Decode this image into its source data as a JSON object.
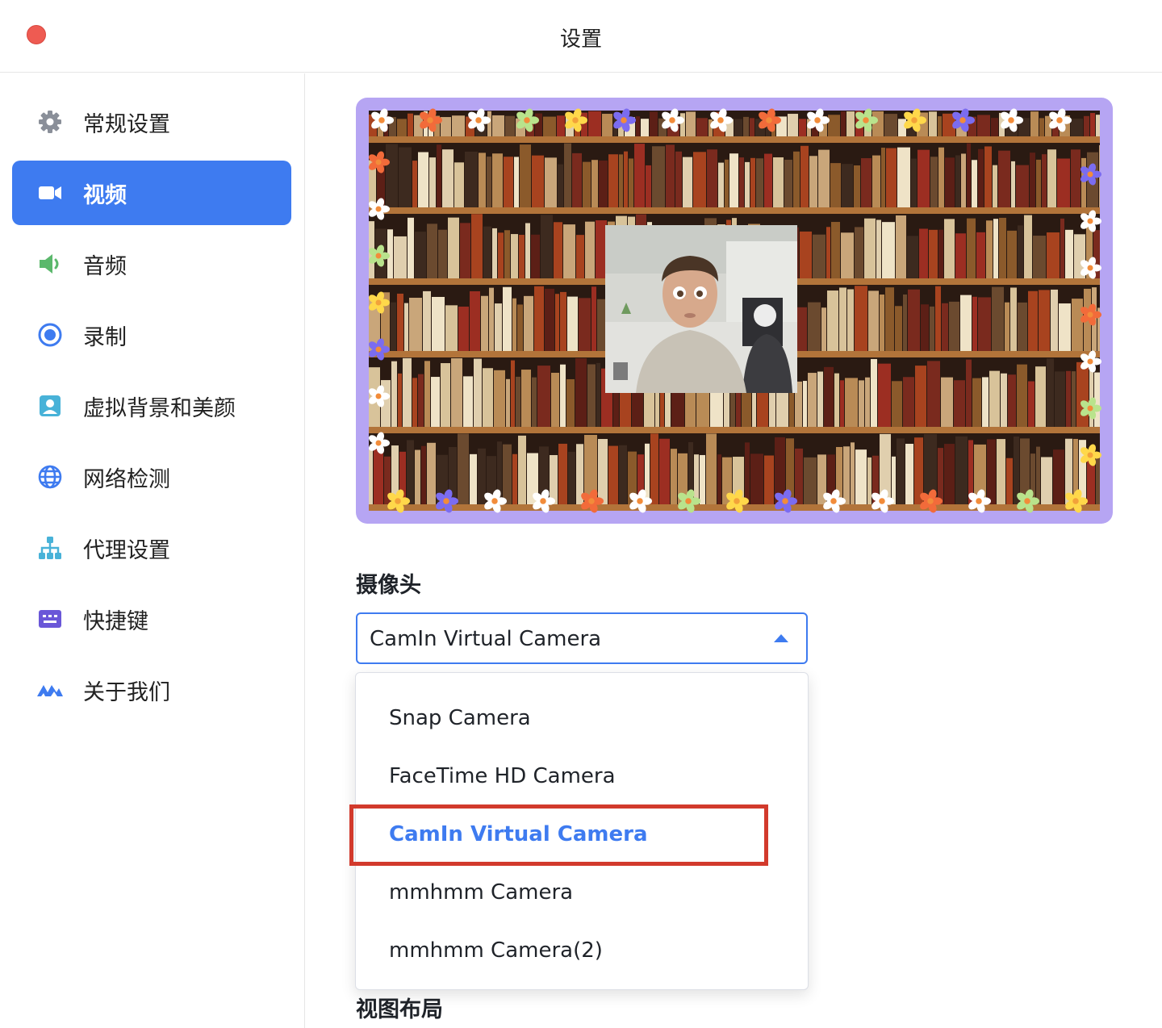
{
  "window": {
    "title": "设置"
  },
  "sidebar": {
    "items": [
      {
        "label": "常规设置",
        "icon": "gear-icon"
      },
      {
        "label": "视频",
        "icon": "video-camera-icon",
        "active": true
      },
      {
        "label": "音频",
        "icon": "speaker-icon"
      },
      {
        "label": "录制",
        "icon": "record-icon"
      },
      {
        "label": "虚拟背景和美颜",
        "icon": "portrait-icon"
      },
      {
        "label": "网络检测",
        "icon": "globe-icon"
      },
      {
        "label": "代理设置",
        "icon": "network-tree-icon"
      },
      {
        "label": "快捷键",
        "icon": "keyboard-icon"
      },
      {
        "label": "关于我们",
        "icon": "logo-icon"
      }
    ]
  },
  "main": {
    "camera_label": "摄像头",
    "camera_select": {
      "value": "CamIn Virtual Camera",
      "options": [
        "Snap Camera",
        "FaceTime HD Camera",
        "CamIn Virtual Camera",
        "mmhmm Camera",
        "mmhmm Camera(2)"
      ],
      "selected_index": 2
    },
    "layout_label": "视图布局"
  },
  "colors": {
    "accent": "#3e7bf0",
    "close": "#ee5b52",
    "frame": "#b6a5f3",
    "highlight": "#d23a2c"
  }
}
